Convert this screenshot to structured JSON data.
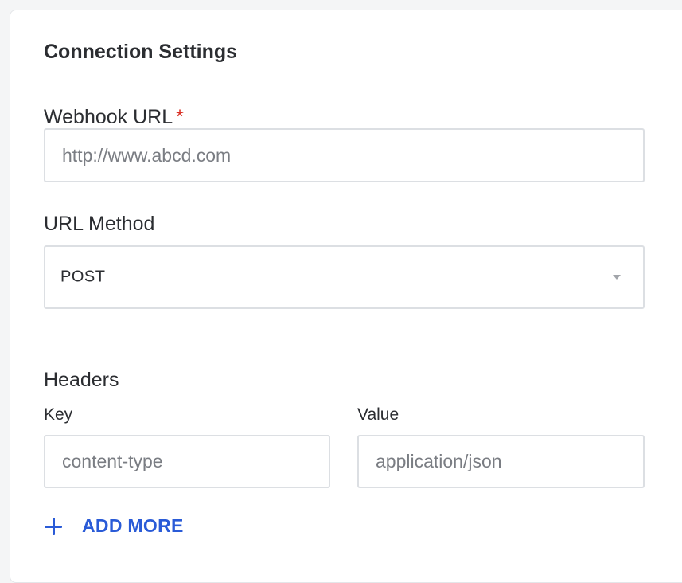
{
  "connection_settings": {
    "title": "Connection Settings",
    "webhook_url": {
      "label": "Webhook URL",
      "required_marker": "*",
      "placeholder": "http://www.abcd.com",
      "value": ""
    },
    "url_method": {
      "label": "URL Method",
      "selected": "POST"
    },
    "headers": {
      "title": "Headers",
      "key_label": "Key",
      "value_label": "Value",
      "rows": [
        {
          "key_placeholder": "content-type",
          "value_placeholder": "application/json"
        }
      ],
      "add_more_label": "ADD MORE"
    }
  },
  "icons": {
    "select_caret": "chevron-down-icon",
    "add": "plus-icon"
  },
  "colors": {
    "accent": "#2a5bd7",
    "required": "#d93025",
    "border": "#dcdfe3"
  }
}
